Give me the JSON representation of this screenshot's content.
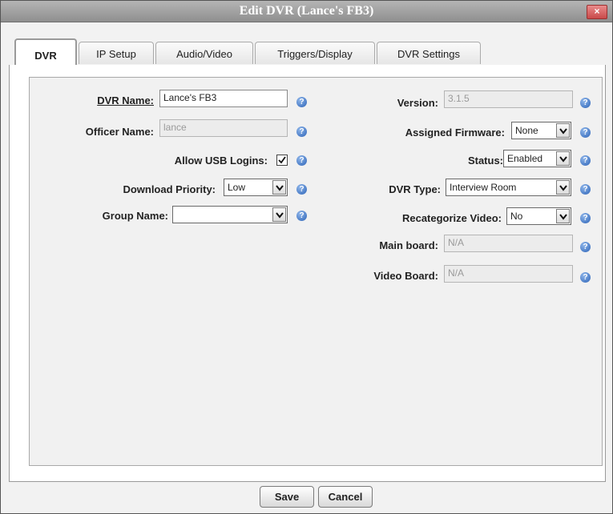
{
  "window": {
    "title": "Edit DVR (Lance's FB3)",
    "close_label": "×"
  },
  "tabs": [
    {
      "label": "DVR",
      "active": true
    },
    {
      "label": "IP Setup",
      "active": false
    },
    {
      "label": "Audio/Video",
      "active": false
    },
    {
      "label": "Triggers/Display",
      "active": false
    },
    {
      "label": "DVR Settings",
      "active": false
    }
  ],
  "left": {
    "dvr_name": {
      "label": "DVR Name:",
      "value": "Lance's FB3"
    },
    "officer_name": {
      "label": "Officer Name:",
      "value": "lance"
    },
    "allow_usb": {
      "label": "Allow USB Logins:",
      "checked": true
    },
    "download_priority": {
      "label": "Download Priority:",
      "value": "Low"
    },
    "group_name": {
      "label": "Group Name:",
      "value": ""
    }
  },
  "right": {
    "version": {
      "label": "Version:",
      "value": "3.1.5"
    },
    "assigned_firmware": {
      "label": "Assigned Firmware:",
      "value": "None"
    },
    "status": {
      "label": "Status:",
      "value": "Enabled"
    },
    "dvr_type": {
      "label": "DVR Type:",
      "value": "Interview Room"
    },
    "recategorize_video": {
      "label": "Recategorize Video:",
      "value": "No"
    },
    "main_board": {
      "label": "Main board:",
      "value": "N/A"
    },
    "video_board": {
      "label": "Video Board:",
      "value": "N/A"
    }
  },
  "help_glyph": "?",
  "buttons": {
    "save": "Save",
    "cancel": "Cancel"
  },
  "colors": {
    "help_icon": "#2d64b8",
    "close_button": "#c94a4a",
    "titlebar": "#a3a3a3"
  }
}
